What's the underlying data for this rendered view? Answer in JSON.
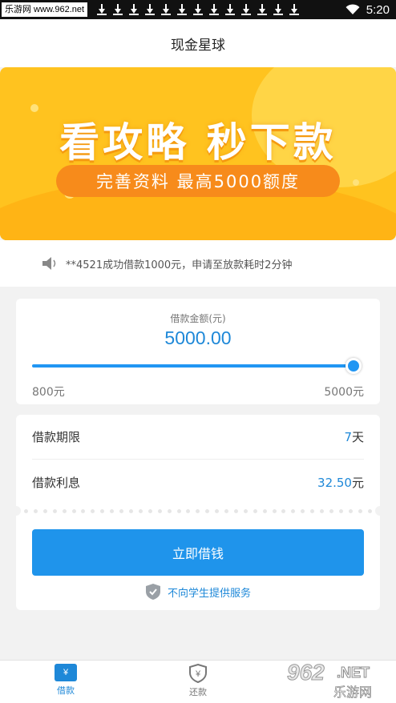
{
  "status_bar": {
    "watermark_text": "乐游网 www.962.net",
    "time": "5:20",
    "icons": [
      "download-icon",
      "download-icon",
      "download-icon",
      "download-icon",
      "download-icon",
      "download-icon",
      "download-icon",
      "download-icon",
      "download-icon",
      "download-icon",
      "download-icon",
      "download-icon",
      "download-icon",
      "wifi-icon"
    ]
  },
  "header": {
    "title": "现金星球"
  },
  "banner": {
    "headline": "看攻略  秒下款",
    "subline": "完善资料   最高5000额度"
  },
  "notice": {
    "text": "**4521成功借款1000元，申请至放款耗时2分钟",
    "icon": "speaker-icon"
  },
  "loan": {
    "amount_label": "借款金额(元)",
    "amount_value": "5000.00",
    "slider_level": 1.0,
    "range_min": "800元",
    "range_max": "5000元",
    "term_label": "借款期限",
    "term_value": "7",
    "term_unit": "天",
    "interest_label": "借款利息",
    "interest_value": "32.50",
    "interest_unit": "元",
    "borrow_button": "立即借钱",
    "student_notice": "不向学生提供服务"
  },
  "tabbar": {
    "tabs": [
      {
        "label": "借款",
        "icon": "ticket-icon",
        "icon_text": "¥",
        "active": true
      },
      {
        "label": "还款",
        "icon": "shield-yen-icon",
        "icon_text": "¥",
        "active": false
      }
    ]
  },
  "watermark": {
    "number": "962",
    "domain": ".NET",
    "name": "乐游网"
  },
  "colors": {
    "accent": "#1f94eb",
    "banner": "#ffc31f",
    "banner_pill": "#f78b1b"
  }
}
